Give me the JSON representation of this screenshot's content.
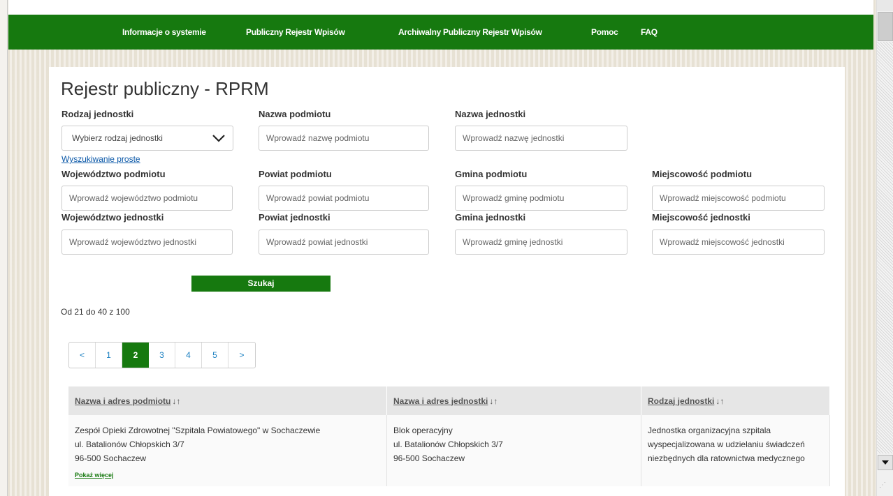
{
  "nav": {
    "items": [
      "Informacje o systemie",
      "Publiczny Rejestr Wpisów",
      "Archiwalny Publiczny Rejestr Wpisów",
      "Pomoc",
      "FAQ"
    ]
  },
  "page": {
    "title": "Rejestr publiczny - RPRM"
  },
  "filters": {
    "rodzaj_label": "Rodzaj jednostki",
    "rodzaj_selected": "Wybierz rodzaj jednostki",
    "nazwa_podmiotu_label": "Nazwa podmiotu",
    "nazwa_podmiotu_placeholder": "Wprowadź nazwę podmiotu",
    "nazwa_jednostki_label": "Nazwa jednostki",
    "nazwa_jednostki_placeholder": "Wprowadź nazwę jednostki",
    "simple_search_link": "Wyszukiwanie proste",
    "woj_podmiotu_label": "Województwo podmiotu",
    "woj_podmiotu_placeholder": "Wprowadź województwo podmiotu",
    "powiat_podmiotu_label": "Powiat podmiotu",
    "powiat_podmiotu_placeholder": "Wprowadź powiat podmiotu",
    "gmina_podmiotu_label": "Gmina podmiotu",
    "gmina_podmiotu_placeholder": "Wprowadź gminę podmiotu",
    "miejscowosc_podmiotu_label": "Miejscowość podmiotu",
    "miejscowosc_podmiotu_placeholder": "Wprowadź miejscowość podmiotu",
    "woj_jednostki_label": "Województwo jednostki",
    "woj_jednostki_placeholder": "Wprowadź województwo jednostki",
    "powiat_jednostki_label": "Powiat jednostki",
    "powiat_jednostki_placeholder": "Wprowadź powiat jednostki",
    "gmina_jednostki_label": "Gmina jednostki",
    "gmina_jednostki_placeholder": "Wprowadź gminę jednostki",
    "miejscowosc_jednostki_label": "Miejscowość jednostki",
    "miejscowosc_jednostki_placeholder": "Wprowadź miejscowość jednostki",
    "search_button": "Szukaj"
  },
  "results_info": "Od 21 do 40 z 100",
  "pagination": {
    "prev": "<",
    "pages": [
      "1",
      "2",
      "3",
      "4",
      "5"
    ],
    "current": "2",
    "next": ">"
  },
  "table": {
    "headers": [
      "Nazwa i adres podmiotu",
      "Nazwa i adres jednostki",
      "Rodzaj jednostki"
    ],
    "sort_icon": "sort-icon",
    "rows": [
      {
        "podmiot": [
          "Zespół Opieki Zdrowotnej \"Szpitala Powiatowego\" w Sochaczewie",
          "ul. Batalionów Chłopskich 3/7",
          "96-500 Sochaczew"
        ],
        "more_link": "Pokaż więcej",
        "jednostka": [
          "Blok operacyjny",
          "ul. Batalionów Chłopskich 3/7",
          "96-500 Sochaczew"
        ],
        "rodzaj": "Jednostka organizacyjna szpitala wyspecjalizowana w udzielaniu świadczeń niezbędnych dla ratownictwa medycznego"
      }
    ]
  },
  "colors": {
    "brand_green": "#16790f",
    "link_blue": "#0b58a8",
    "pagination_blue": "#1a7fc1"
  }
}
